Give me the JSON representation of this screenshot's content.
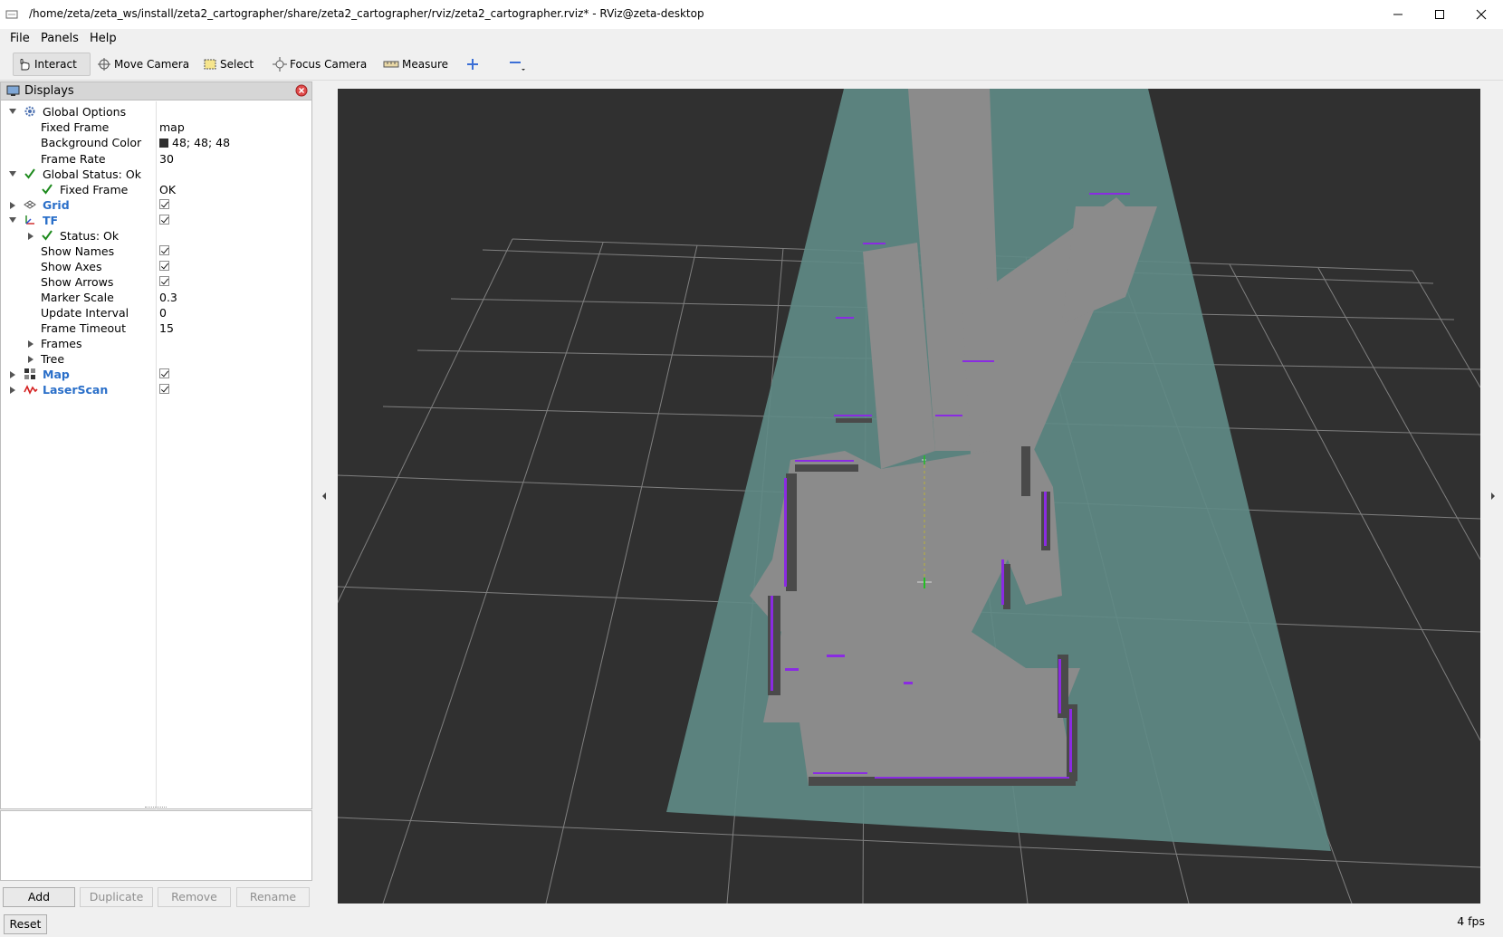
{
  "window": {
    "title": "/home/zeta/zeta_ws/install/zeta2_cartographer/share/zeta2_cartographer/rviz/zeta2_cartographer.rviz* - RViz@zeta-desktop"
  },
  "menu": {
    "file": "File",
    "panels": "Panels",
    "help": "Help"
  },
  "toolbar": {
    "interact": "Interact",
    "move_camera": "Move Camera",
    "select": "Select",
    "focus_camera": "Focus Camera",
    "measure": "Measure"
  },
  "displays_panel": {
    "title": "Displays",
    "global_options": {
      "label": "Global Options",
      "fixed_frame_label": "Fixed Frame",
      "fixed_frame_value": "map",
      "background_color_label": "Background Color",
      "background_color_value": "48; 48; 48",
      "background_color_hex": "#303030",
      "frame_rate_label": "Frame Rate",
      "frame_rate_value": "30"
    },
    "global_status": {
      "label": "Global Status: Ok",
      "fixed_frame_label": "Fixed Frame",
      "fixed_frame_value": "OK"
    },
    "grid": {
      "label": "Grid",
      "enabled": true
    },
    "tf": {
      "label": "TF",
      "enabled": true,
      "status_label": "Status: Ok",
      "show_names_label": "Show Names",
      "show_axes_label": "Show Axes",
      "show_arrows_label": "Show Arrows",
      "marker_scale_label": "Marker Scale",
      "marker_scale_value": "0.3",
      "update_interval_label": "Update Interval",
      "update_interval_value": "0",
      "frame_timeout_label": "Frame Timeout",
      "frame_timeout_value": "15",
      "frames_label": "Frames",
      "tree_label": "Tree"
    },
    "map": {
      "label": "Map",
      "enabled": true
    },
    "laserscan": {
      "label": "LaserScan",
      "enabled": true
    }
  },
  "buttons": {
    "add": "Add",
    "duplicate": "Duplicate",
    "remove": "Remove",
    "rename": "Rename",
    "reset": "Reset"
  },
  "status": {
    "fps": "4 fps"
  },
  "colors": {
    "viewport_bg": "#303030",
    "map_free": "#8c8c8c",
    "map_unknown": "#5f8a86",
    "laser_points": "#8a2be2",
    "accent_blue": "#2a6fc9"
  }
}
